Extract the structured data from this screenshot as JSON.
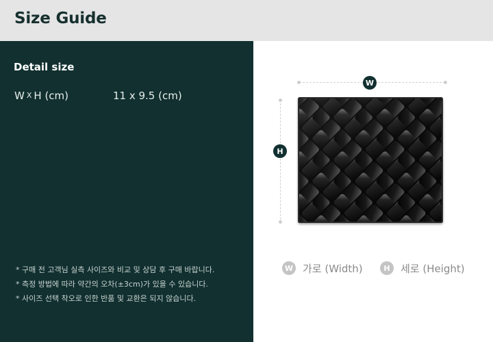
{
  "header": {
    "title": "Size Guide"
  },
  "detail": {
    "title": "Detail size",
    "label_w": "W",
    "label_x": "X",
    "label_h": "H (cm)",
    "value": "11 x 9.5 (cm)"
  },
  "notes": [
    "* 구매 전 고객님 실측 사이즈와 비교 및 상담 후 구매 바랍니다.",
    "* 측정 방법에 따라 약간의 오차(±3cm)가 있을 수 있습니다.",
    "* 사이즈 선택 착오로 인한 반품 및 교환은 되지 않습니다."
  ],
  "diagram": {
    "width_marker": "W",
    "height_marker": "H"
  },
  "legend": {
    "width_marker": "W",
    "width_text": "가로 (Width)",
    "height_marker": "H",
    "height_text": "세로 (Height)"
  },
  "colors": {
    "header_bg": "#e5e5e5",
    "panel_bg": "#11302f",
    "badge_dark": "#11302f",
    "badge_grey": "#c4c4c4"
  }
}
